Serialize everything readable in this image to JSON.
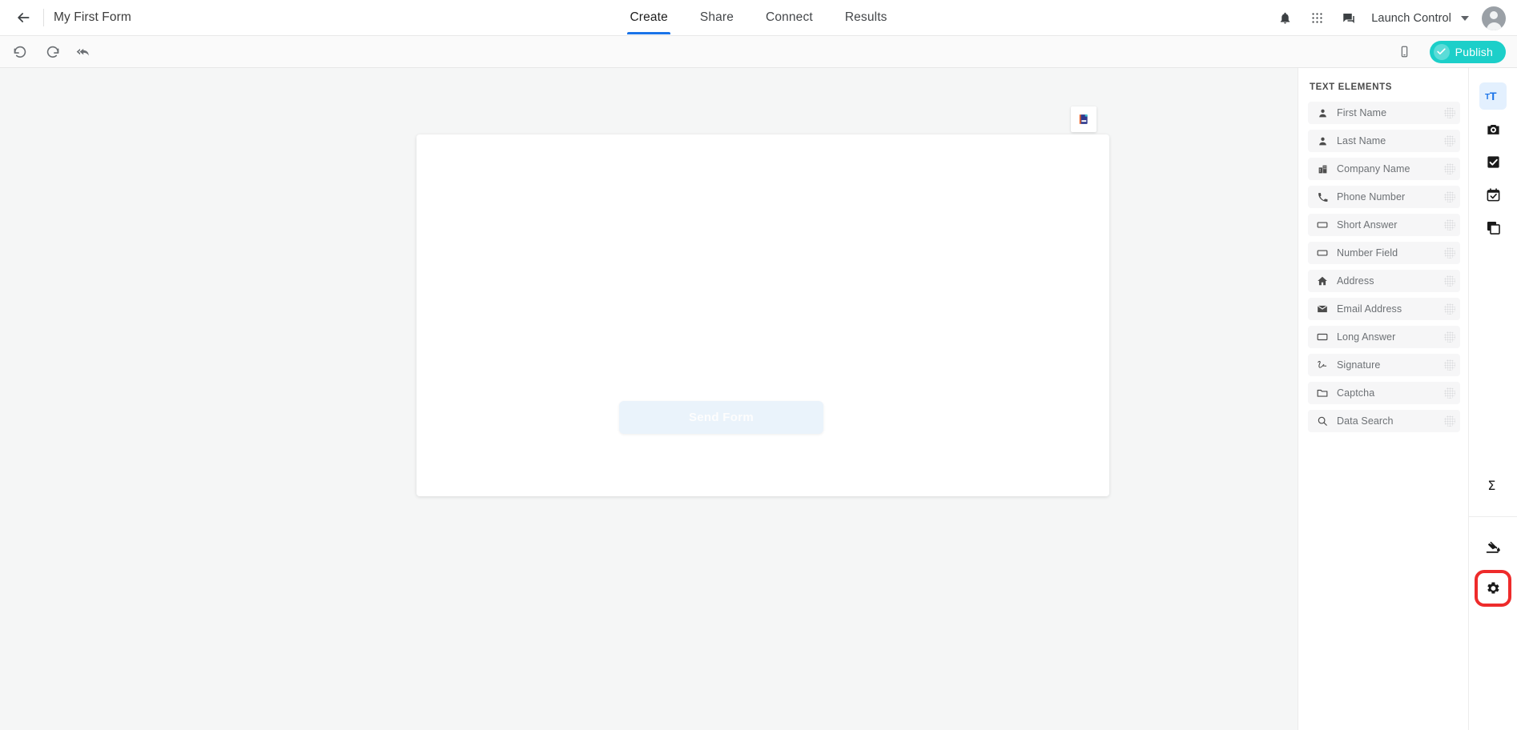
{
  "header": {
    "back_icon": "arrow-left-icon",
    "title": "My First Form",
    "tabs": [
      {
        "label": "Create",
        "active": true
      },
      {
        "label": "Share",
        "active": false
      },
      {
        "label": "Connect",
        "active": false
      },
      {
        "label": "Results",
        "active": false
      }
    ],
    "active_tab_color": "#1a73e8",
    "icons": [
      {
        "name": "notifications-bell-icon"
      },
      {
        "name": "apps-grid-icon"
      },
      {
        "name": "chat-feedback-icon"
      }
    ],
    "org_selector": {
      "label": "Launch Control",
      "caret": "chevron-down-icon"
    },
    "avatar": "user-avatar-icon"
  },
  "toolbar": {
    "undo_icon": "undo-icon",
    "redo_icon": "redo-icon",
    "revert_icon": "revert-all-icon",
    "mobile_preview_icon": "mobile-device-icon",
    "publish_label": "Publish",
    "publish_color": "#1ccfc9",
    "publish_check_icon": "check-circle-icon"
  },
  "canvas": {
    "page_badge_icon": "page-duplicate-icon",
    "send_form_label": "Send Form",
    "background_color": "#f5f6f6"
  },
  "panel": {
    "title": "TEXT ELEMENTS",
    "items": [
      {
        "label": "First Name",
        "icon": "person-icon"
      },
      {
        "label": "Last Name",
        "icon": "person-icon"
      },
      {
        "label": "Company Name",
        "icon": "building-icon"
      },
      {
        "label": "Phone Number",
        "icon": "phone-icon"
      },
      {
        "label": "Short Answer",
        "icon": "text-box-icon"
      },
      {
        "label": "Number Field",
        "icon": "text-box-icon"
      },
      {
        "label": "Address",
        "icon": "home-icon"
      },
      {
        "label": "Email Address",
        "icon": "email-icon"
      },
      {
        "label": "Long Answer",
        "icon": "text-box-icon"
      },
      {
        "label": "Signature",
        "icon": "signature-icon"
      },
      {
        "label": "Captcha",
        "icon": "folder-icon"
      },
      {
        "label": "Data Search",
        "icon": "search-icon"
      }
    ],
    "drag_handle_icon": "drag-dots-icon"
  },
  "rail": {
    "items": [
      {
        "name": "text-elements-icon",
        "active": true,
        "highlighted": false
      },
      {
        "name": "media-camera-icon",
        "active": false,
        "highlighted": false
      },
      {
        "name": "choice-checkbox-icon",
        "active": false,
        "highlighted": false
      },
      {
        "name": "date-calendar-icon",
        "active": false,
        "highlighted": false
      },
      {
        "name": "layout-pages-icon",
        "active": false,
        "highlighted": false
      }
    ],
    "bottom_items": [
      {
        "name": "calculation-sigma-icon",
        "active": false,
        "highlighted": false
      },
      {
        "name": "theme-paint-icon",
        "active": false,
        "highlighted": false
      },
      {
        "name": "settings-gear-icon",
        "active": false,
        "highlighted": true
      }
    ],
    "highlight_color": "#ee2b2b"
  }
}
